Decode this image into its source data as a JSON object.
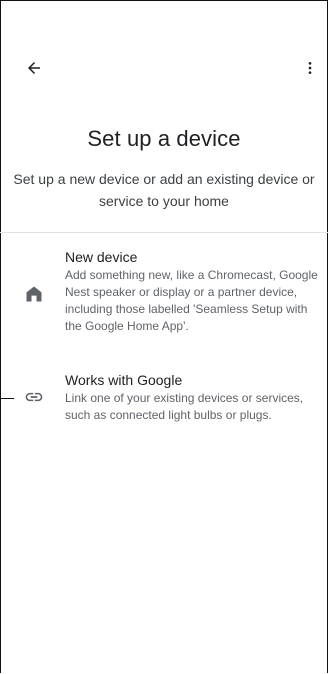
{
  "header": {
    "back_icon": "arrow-back-icon",
    "more_icon": "more-vert-icon"
  },
  "page": {
    "title": "Set up a device",
    "subtitle": "Set up a new device or add an existing device or service to your home"
  },
  "options": [
    {
      "icon": "home-icon",
      "title": "New device",
      "description": "Add something new, like a Chromecast, Google Nest speaker or display or a partner device, including those labelled 'Seamless Setup with the Google Home App'."
    },
    {
      "icon": "link-icon",
      "title": "Works with Google",
      "description": "Link one of your existing devices or services, such as connected light bulbs or plugs."
    }
  ],
  "colors": {
    "text_primary": "#202124",
    "text_secondary": "#5f6368",
    "icon": "#5f6368",
    "divider": "#e0e0e0"
  }
}
